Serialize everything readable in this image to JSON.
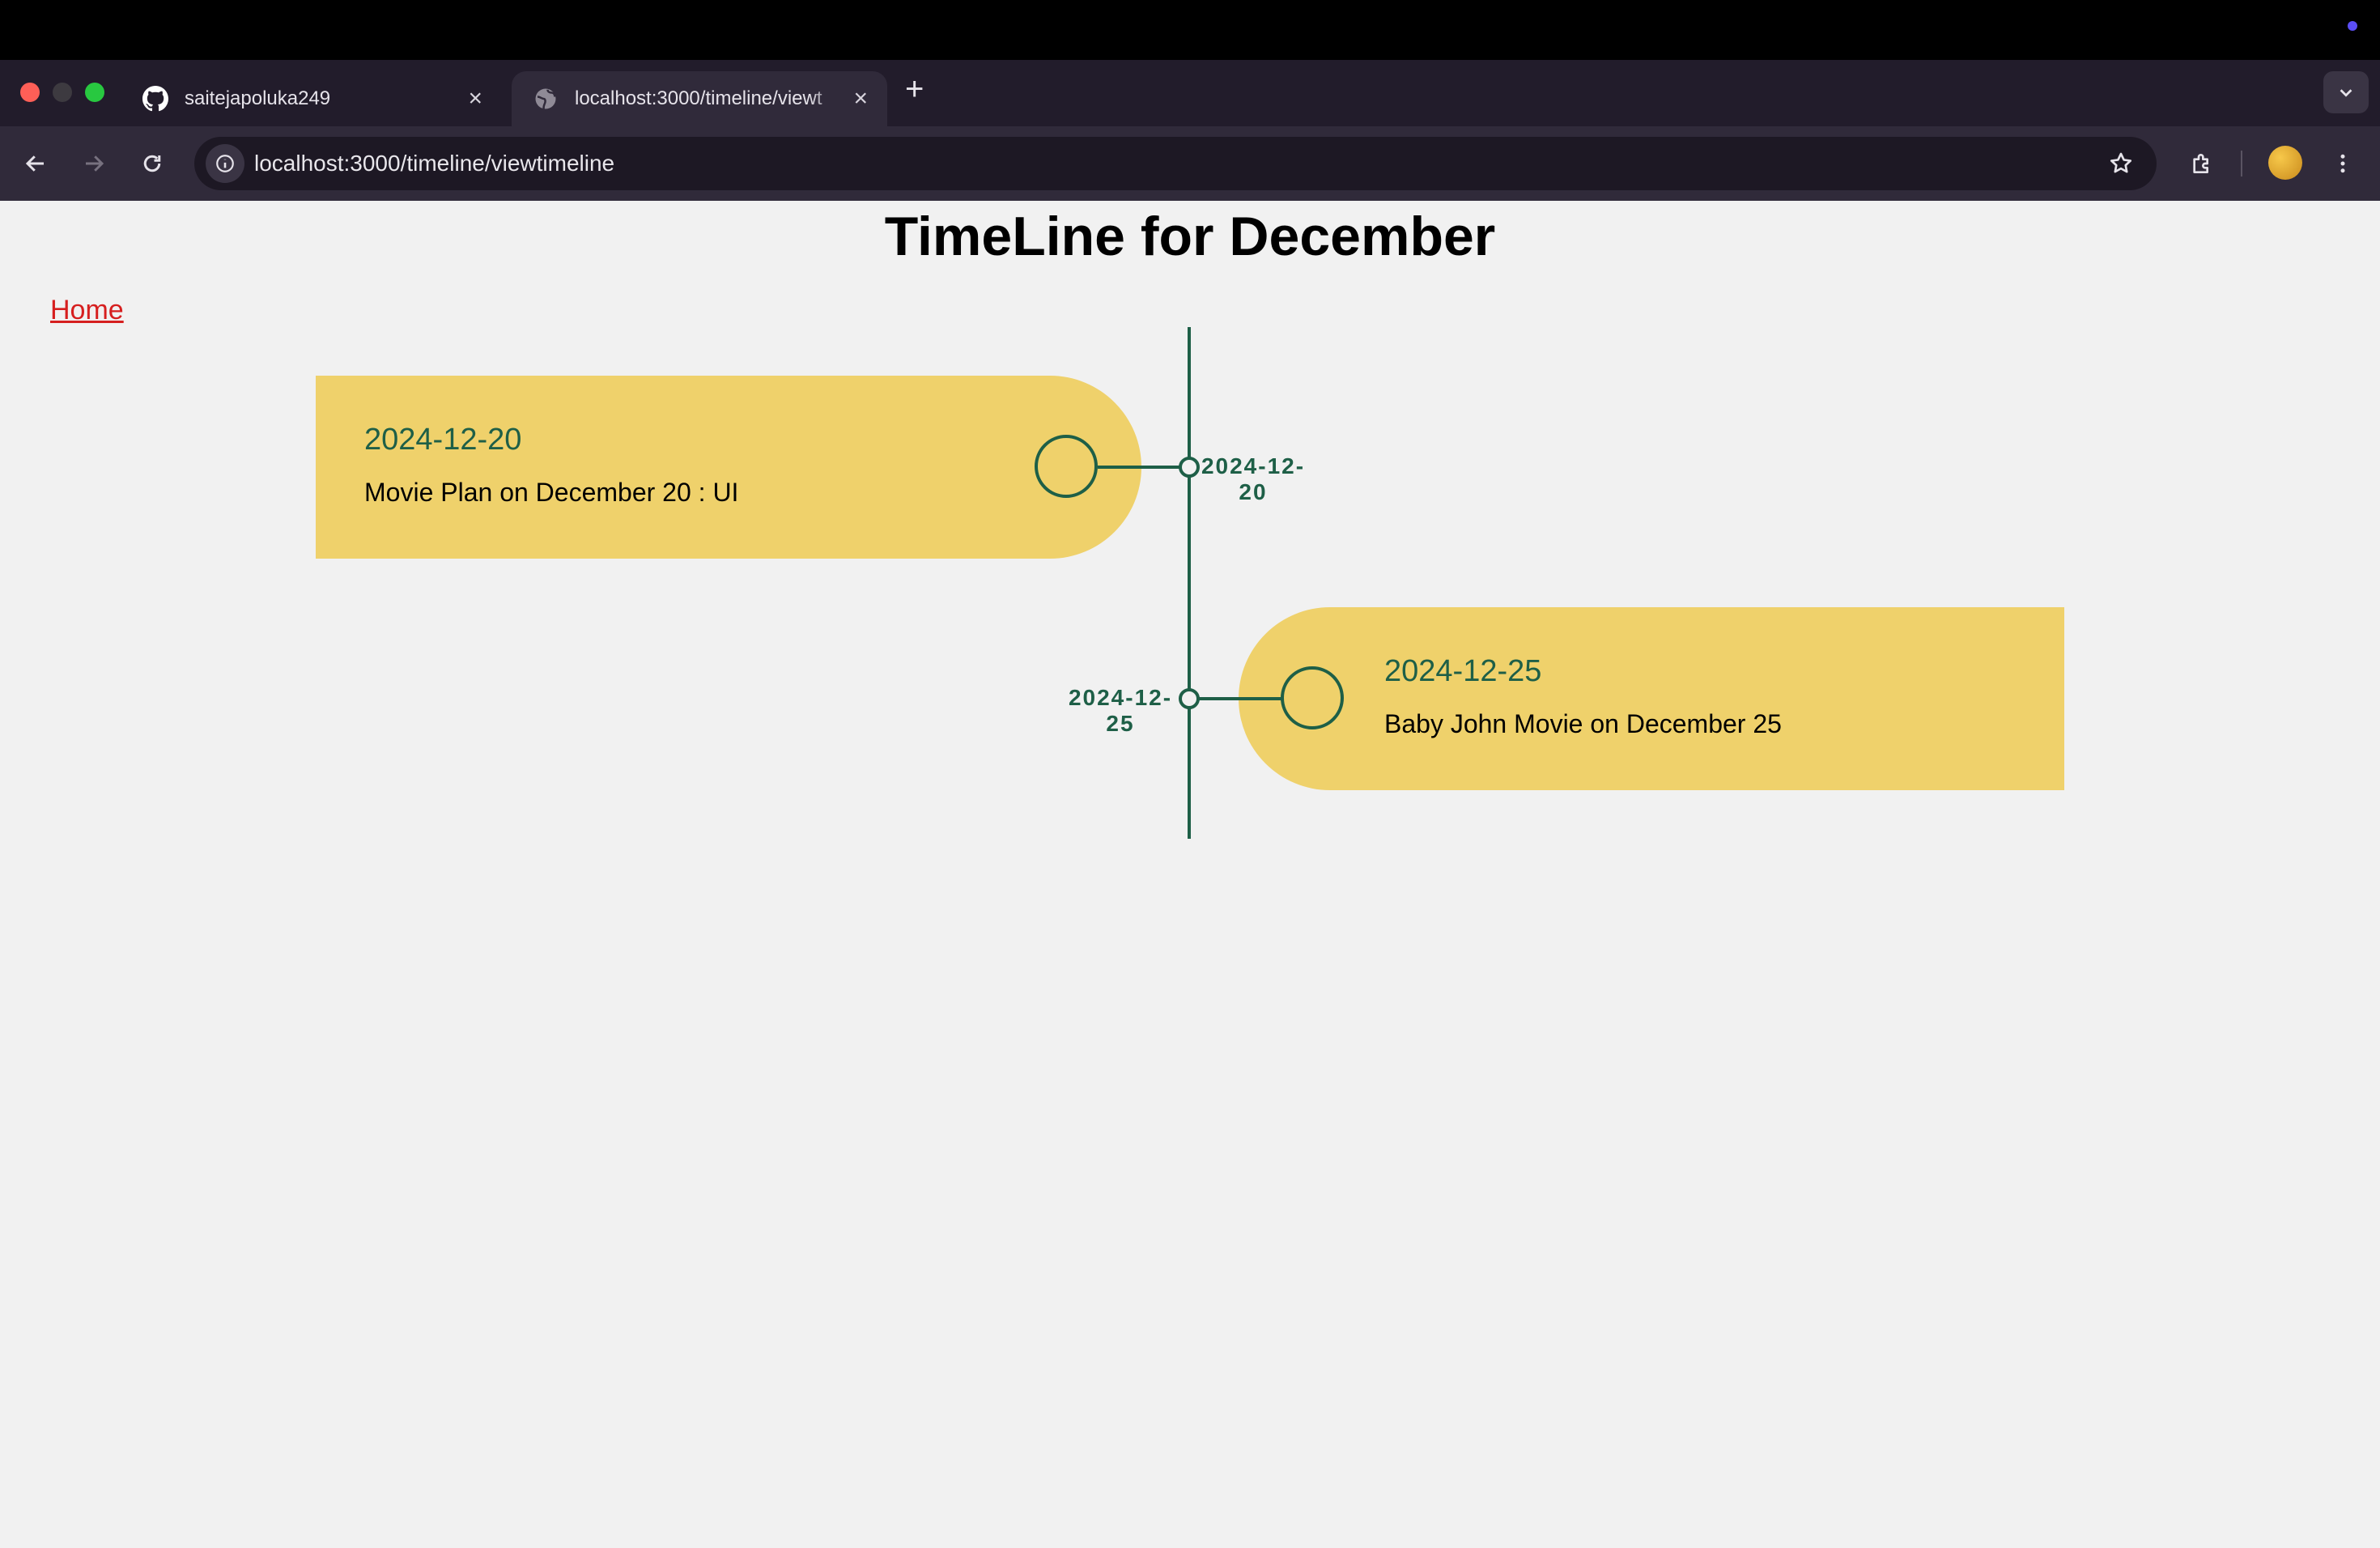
{
  "browser": {
    "tabs": [
      {
        "title": "saitejapoluka249",
        "icon": "github-icon",
        "active": false
      },
      {
        "title": "localhost:3000/timeline/viewt",
        "icon": "globe-icon",
        "active": true
      }
    ],
    "address_bar": {
      "url": "localhost:3000/timeline/viewtimeline"
    }
  },
  "page": {
    "title": "TimeLine for December",
    "home_link": "Home",
    "colors": {
      "card": "#efd16b",
      "accent": "#1e5f47",
      "link": "#d61f1f",
      "background": "#f1f1f1"
    },
    "events": [
      {
        "date": "2024-12-20",
        "description": "Movie Plan on December 20 : UI",
        "label_line1": "2024-12-",
        "label_line2": "20",
        "side": "left"
      },
      {
        "date": "2024-12-25",
        "description": "Baby John Movie on December 25",
        "label_line1": "2024-12-",
        "label_line2": "25",
        "side": "right"
      }
    ]
  }
}
